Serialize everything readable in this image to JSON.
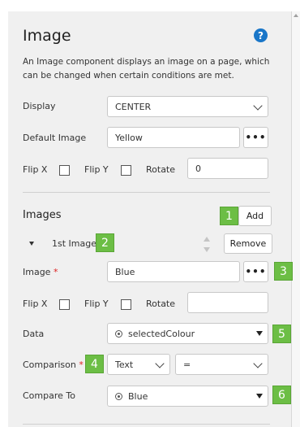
{
  "panel": {
    "title": "Image",
    "help_icon_glyph": "?",
    "description": "An Image component displays an image on a page, which can be changed when certain conditions are met."
  },
  "form": {
    "display_label": "Display",
    "display_value": "CENTER",
    "default_image_label": "Default Image",
    "default_image_value": "Yellow",
    "browse_glyph": "•••",
    "flip_x_label": "Flip X",
    "flip_y_label": "Flip Y",
    "rotate_label": "Rotate",
    "rotate_value": "0"
  },
  "images": {
    "heading": "Images",
    "add_label": "Add",
    "item": {
      "title": "1st Image",
      "remove_label": "Remove",
      "image_label": "Image",
      "required_mark": "*",
      "image_value": "Blue",
      "flip_x_label": "Flip X",
      "flip_y_label": "Flip Y",
      "rotate_label": "Rotate",
      "rotate_value": "",
      "data_label": "Data",
      "data_value": "selectedColour",
      "comparison_label": "Comparison",
      "comparison_type": "Text",
      "comparison_operator": "=",
      "compare_to_label": "Compare To",
      "compare_to_value": "Blue"
    }
  },
  "callouts": [
    "1",
    "2",
    "3",
    "4",
    "5",
    "6"
  ],
  "colors": {
    "callout": "#6cbe45",
    "help": "#1976c8",
    "panel_bg": "#f0f0f0"
  }
}
